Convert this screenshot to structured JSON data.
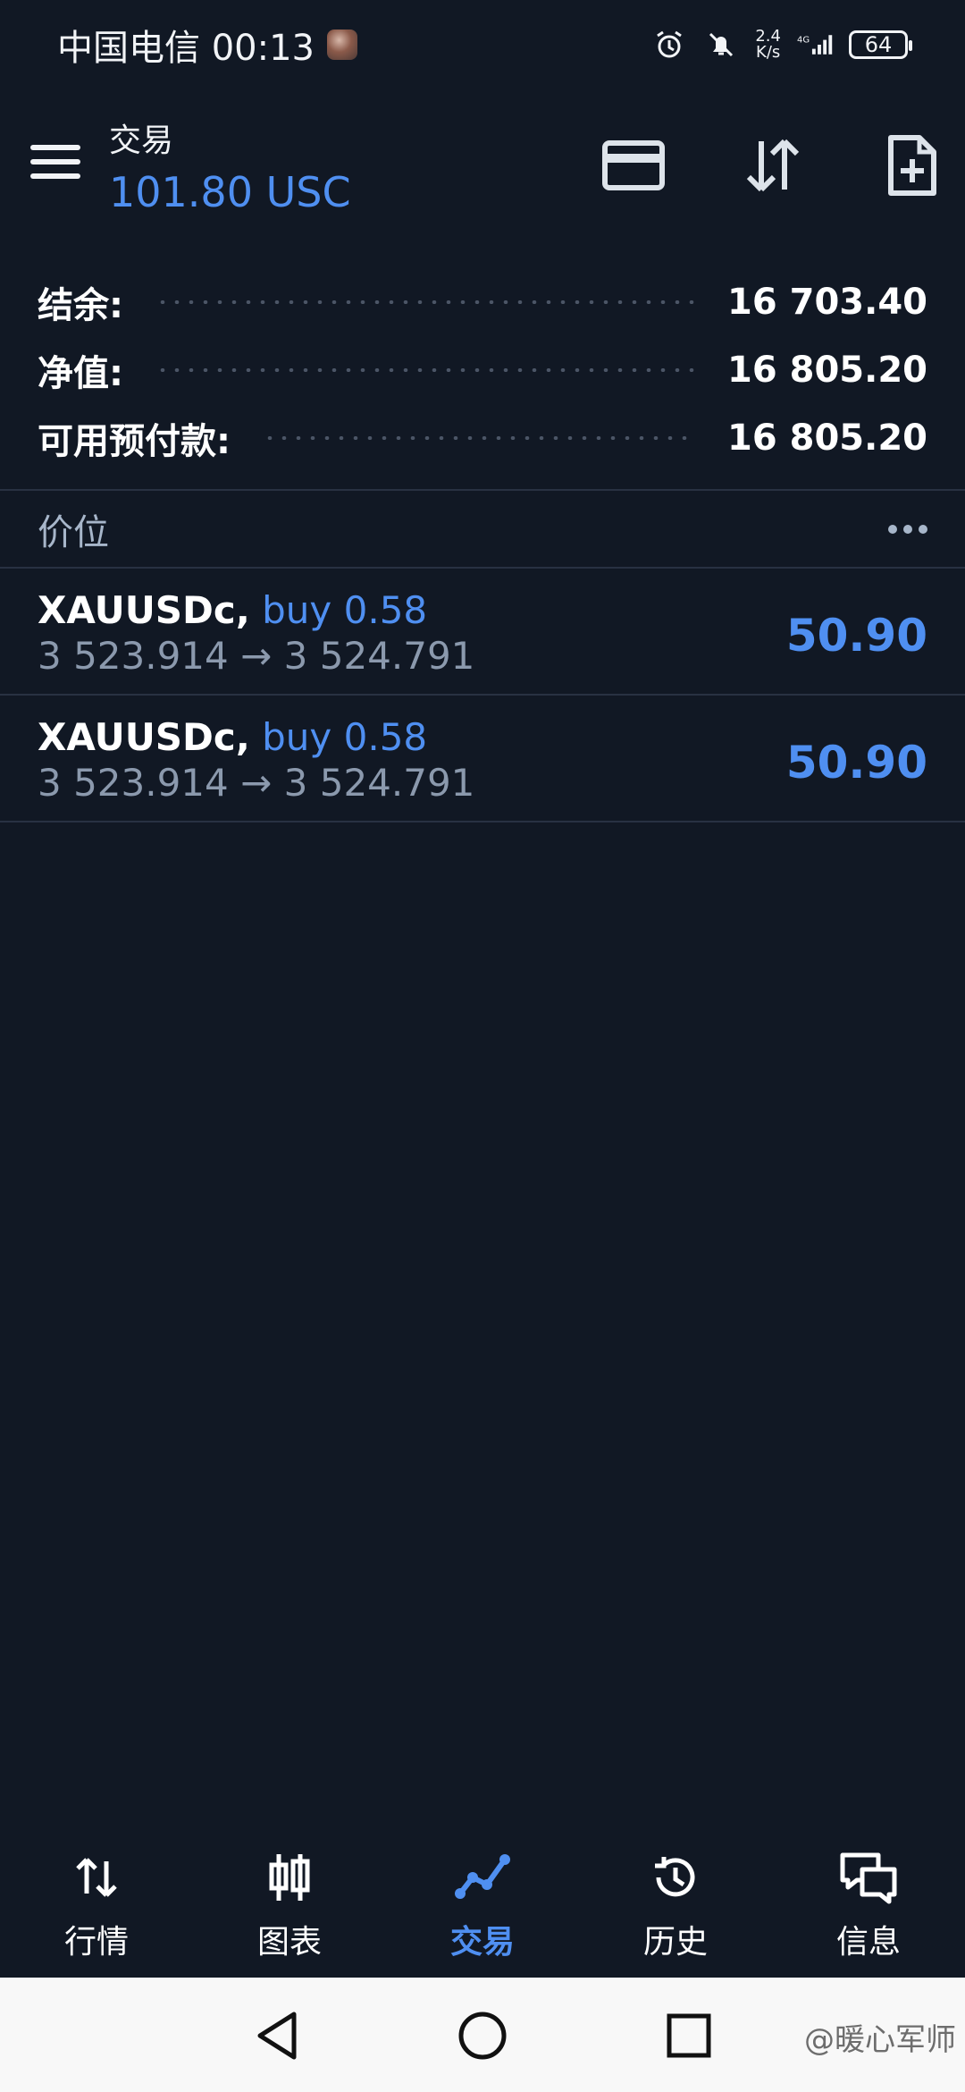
{
  "status_bar": {
    "carrier_time": "中国电信 00:13",
    "net_speed_top": "2.4",
    "net_speed_bottom": "K/s",
    "network_type": "4G",
    "battery": "64"
  },
  "header": {
    "title": "交易",
    "balance_currency": "101.80 USC"
  },
  "summary": {
    "rows": [
      {
        "label": "结余:",
        "value": "16 703.40"
      },
      {
        "label": "净值:",
        "value": "16 805.20"
      },
      {
        "label": "可用预付款:",
        "value": "16 805.20"
      }
    ]
  },
  "positions_section": {
    "title": "价位",
    "rows": [
      {
        "symbol": "XAUUSDc,",
        "side": "buy 0.58",
        "prices": "3 523.914 → 3 524.791",
        "profit": "50.90"
      },
      {
        "symbol": "XAUUSDc,",
        "side": "buy 0.58",
        "prices": "3 523.914 → 3 524.791",
        "profit": "50.90"
      }
    ]
  },
  "bottom_nav": {
    "items": [
      {
        "label": "行情",
        "icon": "quotes-icon"
      },
      {
        "label": "图表",
        "icon": "chart-icon"
      },
      {
        "label": "交易",
        "icon": "trade-icon",
        "active": true
      },
      {
        "label": "历史",
        "icon": "history-icon"
      },
      {
        "label": "信息",
        "icon": "messages-icon"
      }
    ]
  },
  "watermark": "@暖心军师",
  "colors": {
    "background": "#111824",
    "accent": "#4f8ff1",
    "muted": "#8b99ad"
  }
}
